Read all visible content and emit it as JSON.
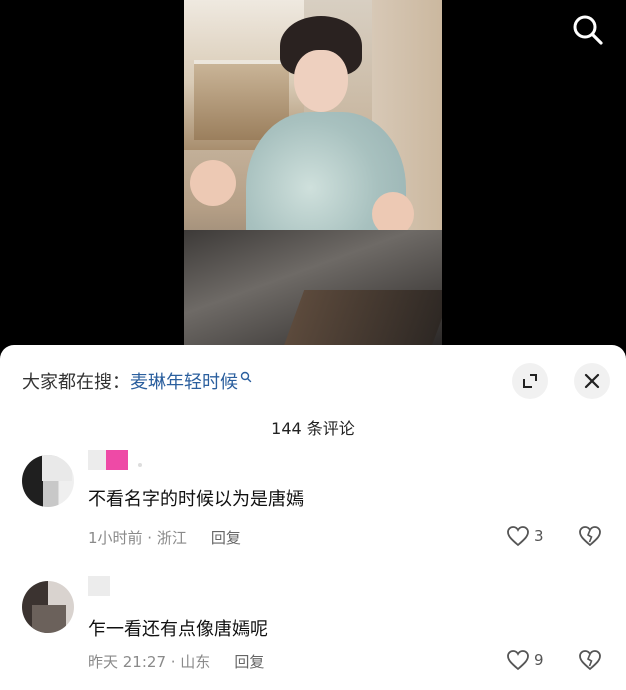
{
  "video": {
    "search_icon": "search-icon"
  },
  "sheet": {
    "suggest_prefix": "大家都在搜：",
    "suggest_term": "麦琳年轻时候",
    "suggest_icon": "search-icon",
    "expand_icon": "expand-icon",
    "close_icon": "close-icon",
    "comment_count": "144 条评论",
    "comments": [
      {
        "text": "不看名字的时候以为是唐嫣",
        "time_location": "1小时前 · 浙江",
        "reply": "回复",
        "likes": "3"
      },
      {
        "text": "乍一看还有点像唐嫣呢",
        "time_location": "昨天 21:27 · 山东",
        "reply": "回复",
        "likes": "9"
      }
    ]
  },
  "colors": {
    "accent_link": "#2b5f9e",
    "badge_pink": "#ee4aa6",
    "meta_gray": "#8a8a8a"
  }
}
